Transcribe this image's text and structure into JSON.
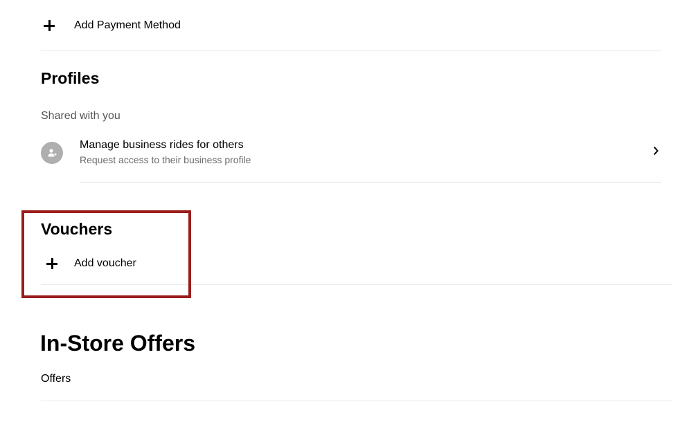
{
  "payment": {
    "add_label": "Add Payment Method"
  },
  "profiles": {
    "title": "Profiles",
    "shared_label": "Shared with you",
    "item": {
      "title": "Manage business rides for others",
      "subtitle": "Request access to their business profile",
      "icon": "person-add-icon"
    }
  },
  "vouchers": {
    "title": "Vouchers",
    "add_label": "Add voucher"
  },
  "in_store": {
    "title": "In-Store Offers",
    "offers_label": "Offers"
  },
  "colors": {
    "highlight": "#9b1c1c",
    "avatar": "#afafaf",
    "divider": "#e8e8e8"
  }
}
